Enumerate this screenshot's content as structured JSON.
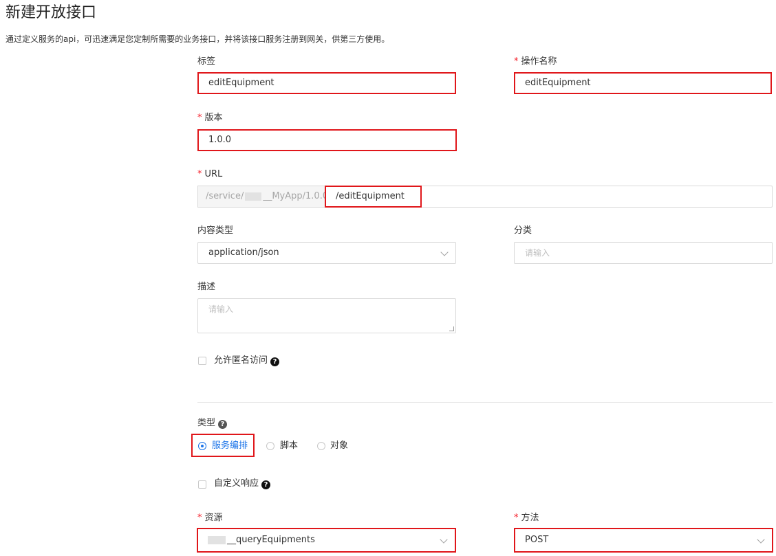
{
  "page": {
    "title": "新建开放接口",
    "subtitle": "通过定义服务的api，可迅速满足您定制所需要的业务接口，并将该接口服务注册到网关，供第三方使用。"
  },
  "form": {
    "tag": {
      "label": "标签",
      "value": "editEquipment"
    },
    "operation_name": {
      "required": "*",
      "label": "操作名称",
      "value": "editEquipment"
    },
    "version": {
      "required": "*",
      "label": "版本",
      "value": "1.0.0"
    },
    "url": {
      "required": "*",
      "label": "URL",
      "prefix_start": "/service/",
      "prefix_end": "__MyApp/1.0.0",
      "value": "/editEquipment"
    },
    "content_type": {
      "label": "内容类型",
      "value": "application/json"
    },
    "category": {
      "label": "分类",
      "placeholder": "请输入"
    },
    "description": {
      "label": "描述",
      "placeholder": "请输入"
    },
    "anonymous": {
      "label": "允许匿名访问",
      "help": "?"
    },
    "type": {
      "label": "类型",
      "help": "?",
      "options": [
        "服务编排",
        "脚本",
        "对象"
      ],
      "selected": "服务编排"
    },
    "custom_response": {
      "label": "自定义响应",
      "help": "?"
    },
    "resource": {
      "required": "*",
      "label": "资源",
      "value": "__queryEquipments"
    },
    "method": {
      "required": "*",
      "label": "方法",
      "value": "POST"
    }
  },
  "colors": {
    "highlight": "#e0161a",
    "primary": "#1a73e8",
    "required": "#f5222d"
  }
}
